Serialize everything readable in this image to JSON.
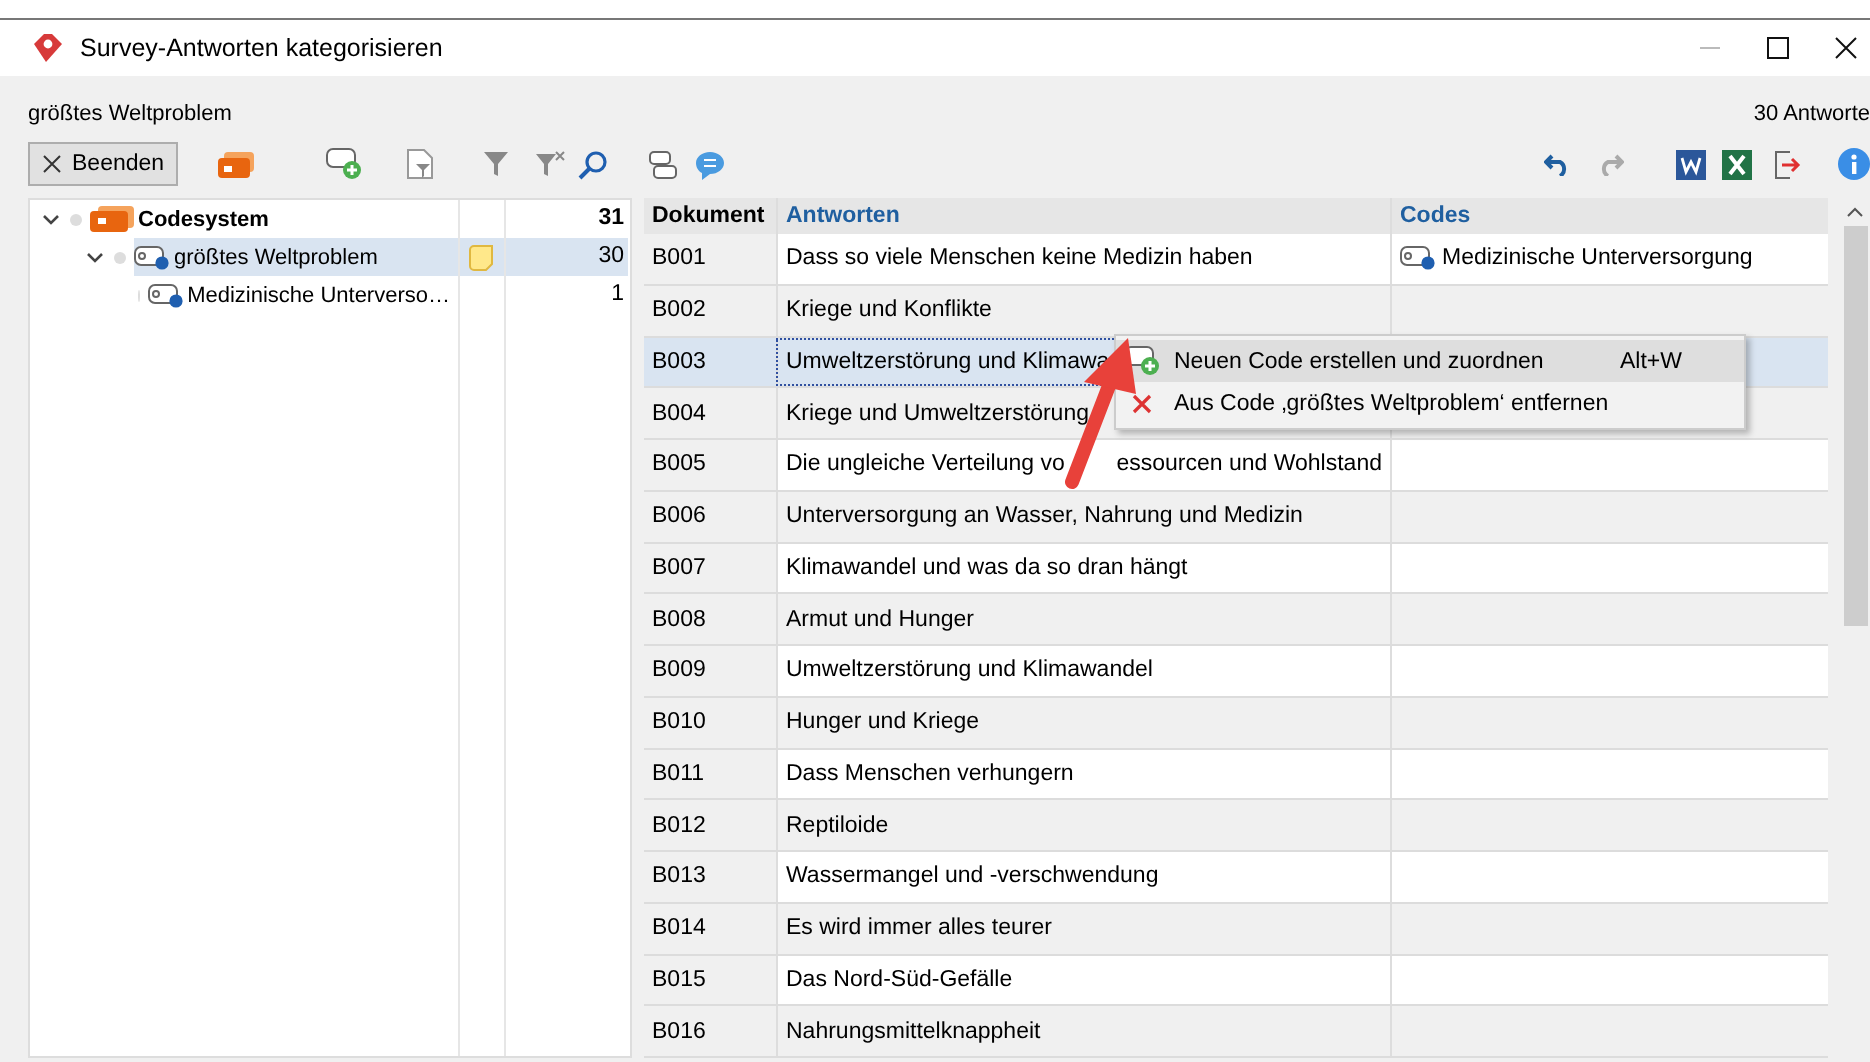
{
  "window": {
    "title": "Survey-Antworten kategorisieren"
  },
  "header": {
    "subtitle": "größtes Weltproblem",
    "count": "30 Antworte"
  },
  "toolbar": {
    "close_button": "Beenden"
  },
  "tree": [
    {
      "name": "Codesystem",
      "count": "31",
      "expanded": true,
      "selected": false,
      "kind": "root",
      "memo": false,
      "children": [
        {
          "name": "größtes Weltproblem",
          "count": "30",
          "expanded": true,
          "selected": true,
          "kind": "code",
          "memo": true,
          "children": [
            {
              "name": "Medizinische Unterverso…",
              "count": "1",
              "selected": false,
              "kind": "code",
              "memo": false
            }
          ]
        }
      ]
    }
  ],
  "table": {
    "columns": [
      "Dokument",
      "Antworten",
      "Codes"
    ],
    "rows": [
      {
        "document": "B001",
        "answer": "Dass so viele Menschen keine Medizin haben",
        "code": "Medizinische Unterversorgung",
        "selected": false
      },
      {
        "document": "B002",
        "answer": "Kriege und Konflikte",
        "selected": false
      },
      {
        "document": "B003",
        "answer": "Umweltzerstörung und Klimawa",
        "selected": true
      },
      {
        "document": "B004",
        "answer": "Kriege und Umweltzerstörung",
        "selected": false
      },
      {
        "document": "B005",
        "answer": "Die ungleiche Verteilung vo",
        "answer_end": "essourcen und Wohlstand",
        "selected": false
      },
      {
        "document": "B006",
        "answer": "Unterversorgung an Wasser, Nahrung und Medizin",
        "selected": false
      },
      {
        "document": "B007",
        "answer": "Klimawandel und was da so dran hängt",
        "selected": false
      },
      {
        "document": "B008",
        "answer": "Armut und Hunger",
        "selected": false
      },
      {
        "document": "B009",
        "answer": "Umweltzerstörung und Klimawandel",
        "selected": false
      },
      {
        "document": "B010",
        "answer": "Hunger und Kriege",
        "selected": false
      },
      {
        "document": "B011",
        "answer": "Dass Menschen verhungern",
        "selected": false
      },
      {
        "document": "B012",
        "answer": "Reptiloide",
        "selected": false
      },
      {
        "document": "B013",
        "answer": "Wassermangel und -verschwendung",
        "selected": false
      },
      {
        "document": "B014",
        "answer": "Es wird immer alles teurer",
        "selected": false
      },
      {
        "document": "B015",
        "answer": "Das Nord-Süd-Gefälle",
        "selected": false
      },
      {
        "document": "B016",
        "answer": "Nahrungsmittelknappheit",
        "selected": false
      }
    ]
  },
  "context_menu": [
    {
      "kind": "add",
      "label": "Neuen Code erstellen und zuordnen",
      "shortcut": "Alt+W",
      "selected": true
    },
    {
      "kind": "remove",
      "label": "Aus Code ‚größtes Weltproblem‘ entfernen",
      "selected": false
    }
  ]
}
